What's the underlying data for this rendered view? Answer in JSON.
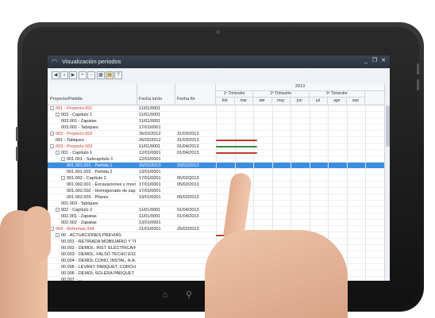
{
  "window": {
    "title": "Visualización periodos"
  },
  "toolbar": {
    "buttons": [
      "first-icon",
      "prev-icon",
      "next-icon",
      "zoom-in-icon",
      "zoom-out-icon",
      "grid-icon",
      "calendar-icon",
      "help-icon"
    ]
  },
  "columns": {
    "project": "Proyecto/Partida",
    "start": "Fecha inicio",
    "end": "Fecha fin"
  },
  "timeline": {
    "year": "2013",
    "quarters": [
      "1º Trimestre",
      "2º Trimestre",
      "3º Trimestre"
    ],
    "months": [
      "feb",
      "mar",
      "abr",
      "may",
      "jun",
      "jul",
      "ago",
      "sep"
    ]
  },
  "rows": [
    {
      "name": "001 - Proyecto 001",
      "start": "11/01/0001",
      "end": "",
      "level": 0,
      "red": true,
      "exp": "-"
    },
    {
      "name": "003 - Capítulo 1",
      "start": "11/01/0001",
      "end": "",
      "level": 1,
      "red": false,
      "exp": "-"
    },
    {
      "name": "003.001 - Zapatas",
      "start": "11/01/0001",
      "end": "",
      "level": 2,
      "red": false,
      "exp": ""
    },
    {
      "name": "003.002 - Tabiques",
      "start": "17/01/0001",
      "end": "",
      "level": 2,
      "red": false,
      "exp": ""
    },
    {
      "name": "002 - Proyecto 002",
      "start": "26/02/2012",
      "end": "31/03/2013",
      "level": 0,
      "red": true,
      "exp": "-"
    },
    {
      "name": "001 - Tabiques",
      "start": "26/02/2012",
      "end": "31/03/2013",
      "level": 1,
      "red": false,
      "exp": ""
    },
    {
      "name": "003 - Proyecto 003",
      "start": "11/01/0001",
      "end": "01/04/2013",
      "level": 0,
      "red": true,
      "exp": "-"
    },
    {
      "name": "001 - Capítulo 1",
      "start": "12/01/0001",
      "end": "01/04/2013",
      "level": 1,
      "red": false,
      "exp": "-"
    },
    {
      "name": "001.001 - Subcapítulo 1",
      "start": "12/01/0001",
      "end": "",
      "level": 2,
      "red": false,
      "exp": "-"
    },
    {
      "name": "001.001.001 - Partida 1",
      "start": "16/01/2013",
      "end": "20/01/2013",
      "level": 3,
      "red": false,
      "exp": "",
      "selected": true
    },
    {
      "name": "001.001.002 - Partida 2",
      "start": "13/01/0001",
      "end": "",
      "level": 3,
      "red": false,
      "exp": ""
    },
    {
      "name": "001.002 - Capítulo 2",
      "start": "17/01/0001",
      "end": "05/02/2013",
      "level": 2,
      "red": false,
      "exp": "-"
    },
    {
      "name": "001.002.001 - Excavaciones y movi",
      "start": "17/01/0001",
      "end": "05/02/2013",
      "level": 3,
      "red": false,
      "exp": ""
    },
    {
      "name": "001.002.002 - Hormigonado de zap",
      "start": "17/01/0001",
      "end": "",
      "level": 3,
      "red": false,
      "exp": ""
    },
    {
      "name": "001.002.003 - Pilares",
      "start": "13/01/0001",
      "end": "05/02/2013",
      "level": 3,
      "red": false,
      "exp": ""
    },
    {
      "name": "001.003 - Tabiques",
      "start": "",
      "end": "",
      "level": 2,
      "red": false,
      "exp": ""
    },
    {
      "name": "002 - Capítulo 2",
      "start": "11/01/0001",
      "end": "01/04/2013",
      "level": 1,
      "red": false,
      "exp": "-"
    },
    {
      "name": "002.001 - Zapatas",
      "start": "11/01/0001",
      "end": "01/04/2013",
      "level": 2,
      "red": false,
      "exp": ""
    },
    {
      "name": "002.002 - Zapatas",
      "start": "13/01/0001",
      "end": "",
      "level": 2,
      "red": false,
      "exp": ""
    },
    {
      "name": "004 - Reformas 004",
      "start": "21/01/0001",
      "end": "25/02/2013",
      "level": 0,
      "red": true,
      "exp": "-"
    },
    {
      "name": "00 - ACTUACIONES PREVIAS",
      "start": "",
      "end": "",
      "level": 1,
      "red": false,
      "exp": "-"
    },
    {
      "name": "00.001 - RETIRADA MOBILIARIO Y TR",
      "start": "",
      "end": "",
      "level": 2,
      "red": false,
      "exp": ""
    },
    {
      "name": "00.002 - DEMOL. INST. ELÉCTRICA/IC",
      "start": "",
      "end": "",
      "level": 2,
      "red": false,
      "exp": ""
    },
    {
      "name": "00.003 - DEMOL. FALSO TECHO ESCA",
      "start": "",
      "end": "",
      "level": 2,
      "red": false,
      "exp": ""
    },
    {
      "name": "00.004 - DEMOL CONO. INSTAL. A.A.",
      "start": "",
      "end": "",
      "level": 2,
      "red": false,
      "exp": ""
    },
    {
      "name": "00.005 - LEVANT. PARQUET, CORCHO",
      "start": "",
      "end": "",
      "level": 2,
      "red": false,
      "exp": ""
    },
    {
      "name": "00.006 - DEMOL SOLERA PARQUET",
      "start": "",
      "end": "",
      "level": 2,
      "red": false,
      "exp": ""
    },
    {
      "name": "00.007 - ...",
      "start": "",
      "end": "",
      "level": 2,
      "red": false,
      "exp": ""
    }
  ],
  "gantt": [
    {
      "row": 5,
      "color": "#c0392b",
      "from": 0.0,
      "to": 2.2
    },
    {
      "row": 6,
      "color": "#3a8a3a",
      "from": 0.0,
      "to": 2.2
    },
    {
      "row": 7,
      "color": "#c0392b",
      "from": 0.0,
      "to": 2.2
    },
    {
      "row": 20,
      "color": "#c0392b",
      "from": 0.0,
      "to": 0.9
    }
  ],
  "colors": {
    "accent": "#3b8de0",
    "project_text": "#c0392b",
    "titlebar": "#2f3742"
  }
}
